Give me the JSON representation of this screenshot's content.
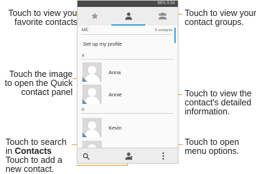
{
  "status": {
    "text": "86% 5:54"
  },
  "phone": {
    "section_me": "ME",
    "contacts_count": "5 contacts",
    "profile_label": "Set up my profile",
    "letters": [
      "A",
      "K"
    ],
    "contacts": [
      "Anna",
      "Annie",
      "Kevin"
    ]
  },
  "callouts": {
    "favorites": [
      "Touch to view your",
      "favorite contacts."
    ],
    "groups": [
      "Touch to view your",
      "contact groups."
    ],
    "quick_contact": [
      "Touch the image",
      "to open the Quick",
      "contact panel"
    ],
    "details": [
      "Touch to view the",
      "contact's detailed",
      "information."
    ],
    "search_prefix": "Touch to search",
    "search_in": "in",
    "search_bold": "Contacts",
    "add": [
      "Touch to add a",
      "new contact."
    ],
    "menu": [
      "Touch to open",
      "menu options."
    ]
  },
  "colors": {
    "accent": "#f39a1e",
    "tab_highlight": "#3aa3e3"
  },
  "icons": [
    "star-icon",
    "person-icon",
    "group-icon",
    "search-icon",
    "add-person-icon",
    "overflow-menu-icon"
  ]
}
